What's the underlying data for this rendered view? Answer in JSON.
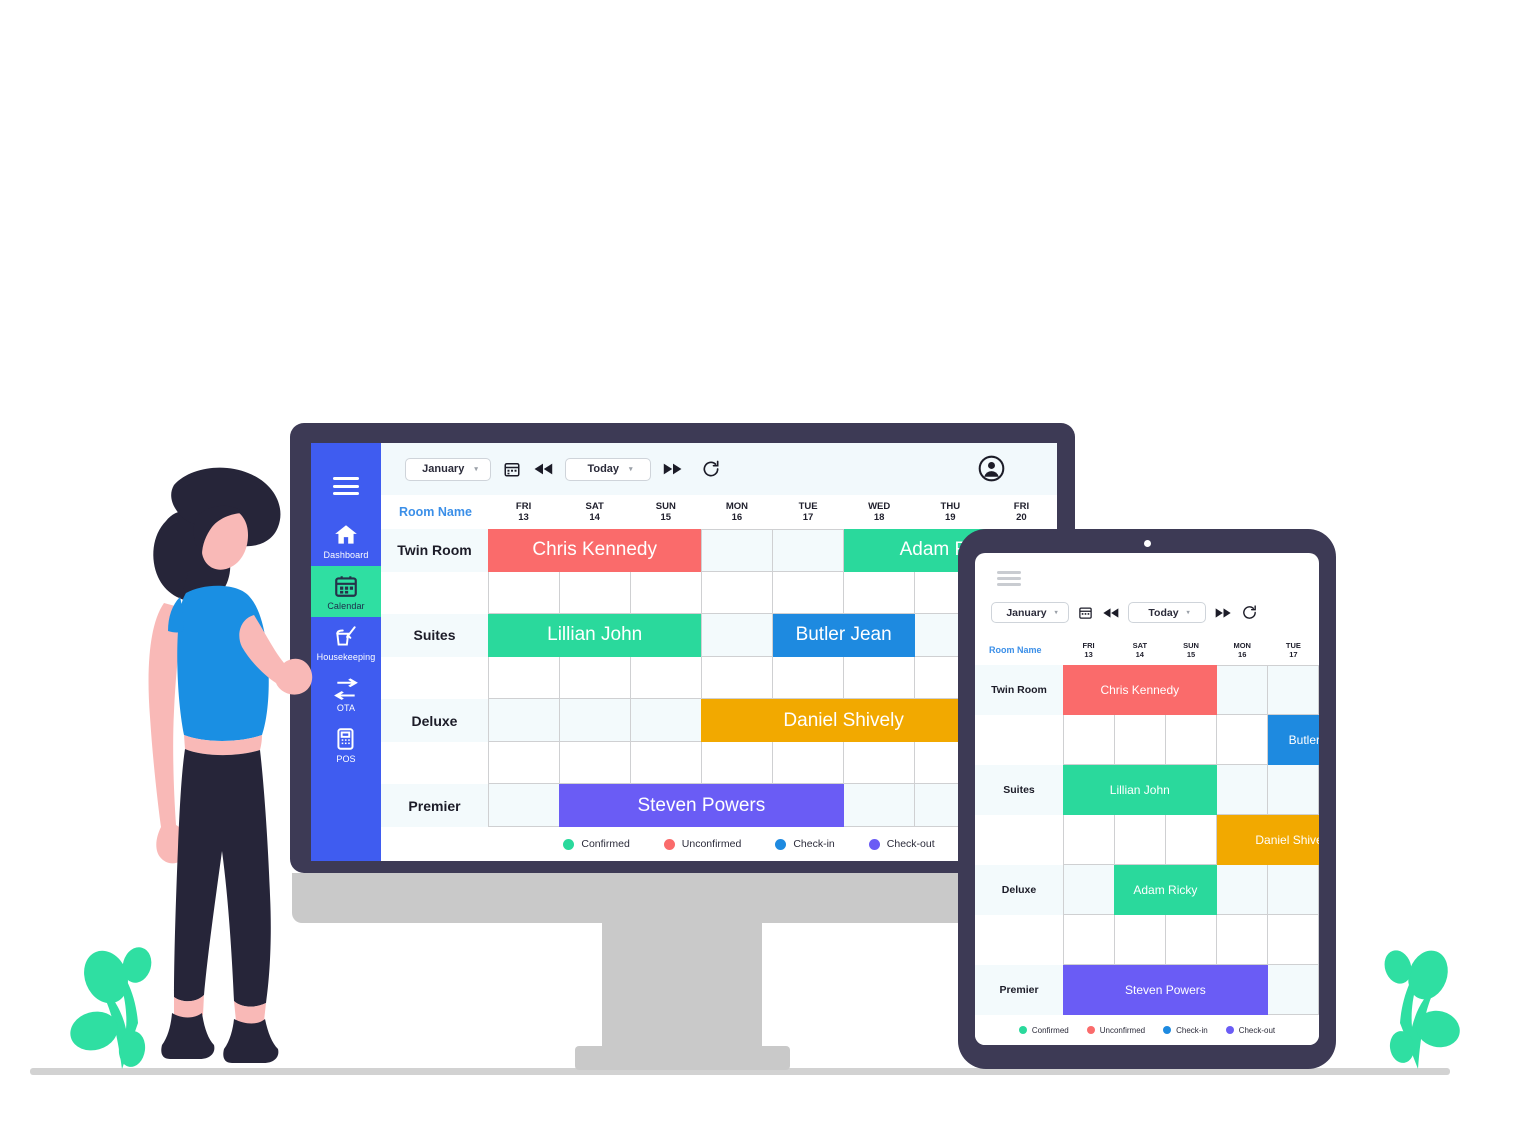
{
  "theme": {
    "sidebar_bg": "#3f5cf0",
    "sidebar_active_bg": "#2fdfa2",
    "device_frame": "#3d3a55",
    "stand_gray": "#c9c9c9",
    "toolbar_bg": "#f2f9fc",
    "row_shade": "#f3fafc",
    "grid_line": "#cfd0d2",
    "room_label_link": "#3b8fe8",
    "plant_green": "#2fdfa2",
    "skin": "#f9b9b7",
    "hair": "#262539",
    "shirt_blue": "#1a8fe3",
    "pants": "#262539"
  },
  "status_colors": {
    "confirmed": "#2ad99c",
    "unconfirmed": "#fa6b6b",
    "checkin": "#1e8ae0",
    "checkout": "#6a5cf5"
  },
  "sidebar": {
    "menu_icon": "hamburger-icon",
    "items": [
      {
        "label": "Dashboard",
        "icon": "home-icon",
        "active": false
      },
      {
        "label": "Calendar",
        "icon": "calendar-icon",
        "active": true
      },
      {
        "label": "Housekeeping",
        "icon": "housekeeping-icon",
        "active": false
      },
      {
        "label": "OTA",
        "icon": "exchange-arrows-icon",
        "active": false
      },
      {
        "label": "POS",
        "icon": "pos-terminal-icon",
        "active": false
      }
    ]
  },
  "toolbar": {
    "month_value": "January",
    "month_caret": "▾",
    "calendar_icon": "calendar-picker-icon",
    "prev_icon": "⏪",
    "today_value": "Today",
    "today_caret": "▾",
    "next_icon": "⏩",
    "refresh_icon": "refresh-icon",
    "avatar_icon": "user-avatar-icon"
  },
  "calendar": {
    "room_column_header": "Room Name",
    "days": [
      {
        "dow": "FRI",
        "num": "13"
      },
      {
        "dow": "SAT",
        "num": "14"
      },
      {
        "dow": "SUN",
        "num": "15"
      },
      {
        "dow": "MON",
        "num": "16"
      },
      {
        "dow": "TUE",
        "num": "17"
      },
      {
        "dow": "WED",
        "num": "18"
      },
      {
        "dow": "THU",
        "num": "19"
      },
      {
        "dow": "FRI",
        "num": "20"
      }
    ],
    "rooms": [
      "Twin Room",
      "",
      "Suites",
      "",
      "Deluxe",
      "",
      "Premier"
    ],
    "bookings": [
      {
        "guest": "Chris Kennedy",
        "row": 0,
        "start": 0,
        "span": 3,
        "status": "unconfirmed",
        "color": "#fa6b6b"
      },
      {
        "guest": "Adam Ricky",
        "row": 0,
        "start": 5,
        "span": 3,
        "status": "confirmed",
        "color": "#2ad99c"
      },
      {
        "guest": "Lillian John",
        "row": 2,
        "start": 0,
        "span": 3,
        "status": "confirmed",
        "color": "#2ad99c"
      },
      {
        "guest": "Butler Jean",
        "row": 2,
        "start": 4,
        "span": 2,
        "status": "checkin",
        "color": "#1e8ae0"
      },
      {
        "guest": "Daniel Shively",
        "row": 4,
        "start": 3,
        "span": 4,
        "status": "pending",
        "color": "#f2a900"
      },
      {
        "guest": "Steven Powers",
        "row": 6,
        "start": 1,
        "span": 4,
        "status": "checkout",
        "color": "#6a5cf5"
      }
    ]
  },
  "legend": [
    {
      "label": "Confirmed",
      "color": "#2ad99c"
    },
    {
      "label": "Unconfirmed",
      "color": "#fa6b6b"
    },
    {
      "label": "Check-in",
      "color": "#fa6b6b"
    },
    {
      "label": "Check-out",
      "color": "#6a5cf5"
    }
  ],
  "legend_fix": [
    {
      "label": "Confirmed",
      "color": "#2ad99c"
    },
    {
      "label": "Unconfirmed",
      "color": "#fa6b6b"
    },
    {
      "label": "Check-in",
      "color": "#1e8ae0"
    },
    {
      "label": "Check-out",
      "color": "#6a5cf5"
    }
  ],
  "tablet": {
    "menu_icon": "hamburger-icon",
    "toolbar": {
      "month_value": "January",
      "today_value": "Today",
      "caret": "▾"
    },
    "room_column_header": "Room Name",
    "days": [
      {
        "dow": "FRI",
        "num": "13"
      },
      {
        "dow": "SAT",
        "num": "14"
      },
      {
        "dow": "SUN",
        "num": "15"
      },
      {
        "dow": "MON",
        "num": "16"
      },
      {
        "dow": "TUE",
        "num": "17"
      }
    ],
    "rooms": [
      "Twin Room",
      "",
      "Suites",
      "",
      "Deluxe",
      "",
      "Premier"
    ],
    "bookings": [
      {
        "guest": "Chris Kennedy",
        "row": 0,
        "start": 0,
        "span": 3,
        "status": "unconfirmed",
        "color": "#fa6b6b"
      },
      {
        "guest": "Butler Jean",
        "row": 1,
        "start": 4,
        "span": 2,
        "status": "checkin",
        "color": "#1e8ae0"
      },
      {
        "guest": "Lillian John",
        "row": 2,
        "start": 0,
        "span": 3,
        "status": "confirmed",
        "color": "#2ad99c"
      },
      {
        "guest": "Daniel Shively",
        "row": 3,
        "start": 3,
        "span": 3,
        "status": "pending",
        "color": "#f2a900"
      },
      {
        "guest": "Adam Ricky",
        "row": 4,
        "start": 1,
        "span": 2,
        "status": "confirmed",
        "color": "#2ad99c"
      },
      {
        "guest": "Steven Powers",
        "row": 6,
        "start": 0,
        "span": 4,
        "status": "checkout",
        "color": "#6a5cf5"
      }
    ],
    "legend": [
      {
        "label": "Confirmed",
        "color": "#2ad99c"
      },
      {
        "label": "Unconfirmed",
        "color": "#fa6b6b"
      },
      {
        "label": "Check-in",
        "color": "#1e8ae0"
      },
      {
        "label": "Check-out",
        "color": "#6a5cf5"
      }
    ]
  },
  "illustration": {
    "person": "woman-pointing-at-screen",
    "plant_left": "leafy-plant-icon",
    "plant_right": "leafy-plant-icon",
    "floor": "ground-line"
  }
}
